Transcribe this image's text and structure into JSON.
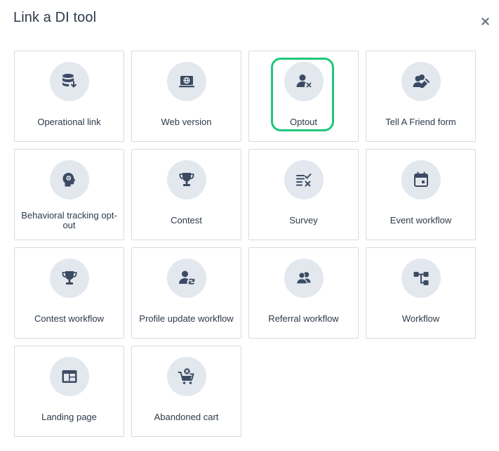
{
  "dialog": {
    "title": "Link a DI tool",
    "close_icon": "close-icon"
  },
  "colors": {
    "icon": "#3c4b63",
    "icon_bg": "#e3e8ef",
    "border": "#d6dbe1",
    "highlight": "#1fc77a"
  },
  "tools": [
    {
      "label": "Operational link",
      "icon": "database-download-icon"
    },
    {
      "label": "Web version",
      "icon": "laptop-globe-icon"
    },
    {
      "label": "Optout",
      "icon": "user-remove-icon",
      "selected": true
    },
    {
      "label": "Tell A Friend form",
      "icon": "users-edit-icon"
    },
    {
      "label": "Behavioral tracking opt-out",
      "icon": "head-gear-icon"
    },
    {
      "label": "Contest",
      "icon": "trophy-icon"
    },
    {
      "label": "Survey",
      "icon": "checklist-icon"
    },
    {
      "label": "Event workflow",
      "icon": "calendar-icon"
    },
    {
      "label": "Contest workflow",
      "icon": "trophy-icon"
    },
    {
      "label": "Profile update workflow",
      "icon": "user-sync-icon"
    },
    {
      "label": "Referral workflow",
      "icon": "users-icon"
    },
    {
      "label": "Workflow",
      "icon": "flow-icon"
    },
    {
      "label": "Landing page",
      "icon": "layout-page-icon"
    },
    {
      "label": "Abandoned cart",
      "icon": "cart-remove-icon"
    }
  ]
}
